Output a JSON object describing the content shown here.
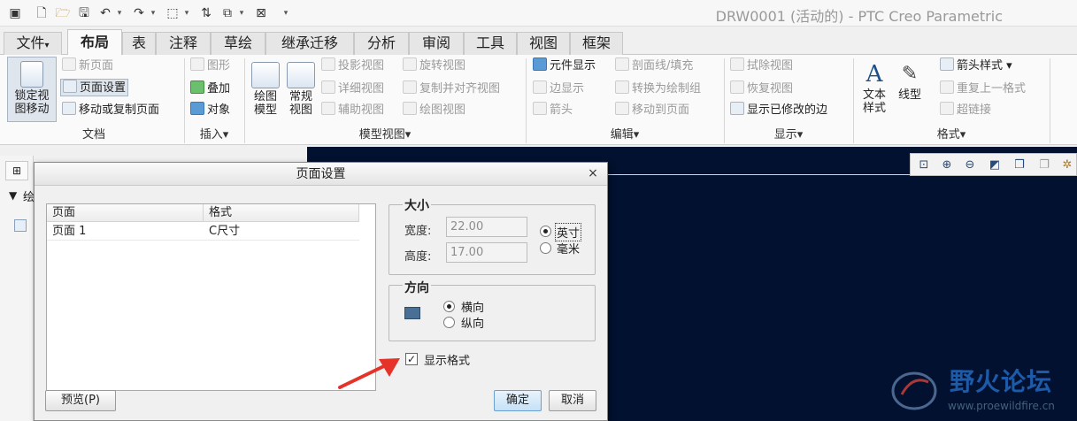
{
  "window": {
    "title": "DRW0001 (活动的) - PTC Creo Parametric"
  },
  "ribbon_tabs": [
    {
      "label": "文件",
      "dropdown": "▾"
    },
    {
      "label": "布局",
      "active": true
    },
    {
      "label": "表"
    },
    {
      "label": "注释"
    },
    {
      "label": "草绘"
    },
    {
      "label": "继承迁移"
    },
    {
      "label": "分析"
    },
    {
      "label": "审阅"
    },
    {
      "label": "工具"
    },
    {
      "label": "视图"
    },
    {
      "label": "框架"
    }
  ],
  "ribbon": {
    "document": {
      "lock_view_label_line1": "锁定视",
      "lock_view_label_line2": "图移动",
      "new_page": "新页面",
      "page_setup": "页面设置",
      "move_copy_page": "移动或复制页面",
      "group_label": "文档"
    },
    "insert": {
      "graphics": "图形",
      "overlay": "叠加",
      "object": "对象",
      "group_label": "插入▾"
    },
    "model_views": {
      "drawing_model_line1": "绘图",
      "drawing_model_line2": "模型",
      "general_view_line1": "常规",
      "general_view_line2": "视图",
      "projection_view": "投影视图",
      "detailed_view": "详细视图",
      "auxiliary_view": "辅助视图",
      "revolved_view": "旋转视图",
      "copy_align_view": "复制并对齐视图",
      "drawing_view": "绘图视图",
      "group_label": "模型视图▾"
    },
    "edit": {
      "element_display": "元件显示",
      "edge_display": "边显示",
      "arrows": "箭头",
      "section_line_fill": "剖面线/填充",
      "convert_to_draw_group": "转换为绘制组",
      "move_to_page": "移动到页面",
      "group_label": "编辑▾"
    },
    "display": {
      "erase_view": "拭除视图",
      "resume_view": "恢复视图",
      "show_modified_edges": "显示已修改的边",
      "group_label": "显示▾"
    },
    "format": {
      "text_style_line1": "文本",
      "text_style_line2": "样式",
      "line_style": "线型",
      "arrow_style": "箭头样式 ▾",
      "repeat_last_format": "重复上一格式",
      "hyperlink": "超链接",
      "group_label": "格式▾"
    }
  },
  "left_panel": {
    "tree_item_partial": "绘"
  },
  "dialog": {
    "title": "页面设置",
    "close_glyph": "×",
    "table": {
      "headers": [
        "页面",
        "格式"
      ],
      "rows": [
        [
          "页面 1",
          "C尺寸"
        ]
      ]
    },
    "size": {
      "title": "大小",
      "width_label": "宽度:",
      "width_value": "22.00",
      "height_label": "高度:",
      "height_value": "17.00",
      "unit_inch": "英寸",
      "unit_mm": "毫米",
      "selected_unit": "英寸"
    },
    "orientation": {
      "title": "方向",
      "landscape": "横向",
      "portrait": "纵向",
      "selected": "横向"
    },
    "show_format": {
      "label": "显示格式",
      "checked": true
    },
    "preview_button": "预览(P)",
    "ok_button": "确定",
    "cancel_button": "取消"
  },
  "watermark": {
    "text": "野火论坛",
    "url": "www.proewildfire.cn"
  },
  "colors": {
    "canvas": "#01112f",
    "annotation_arrow": "#e5332a",
    "watermark_text": "#1d5aa8"
  }
}
